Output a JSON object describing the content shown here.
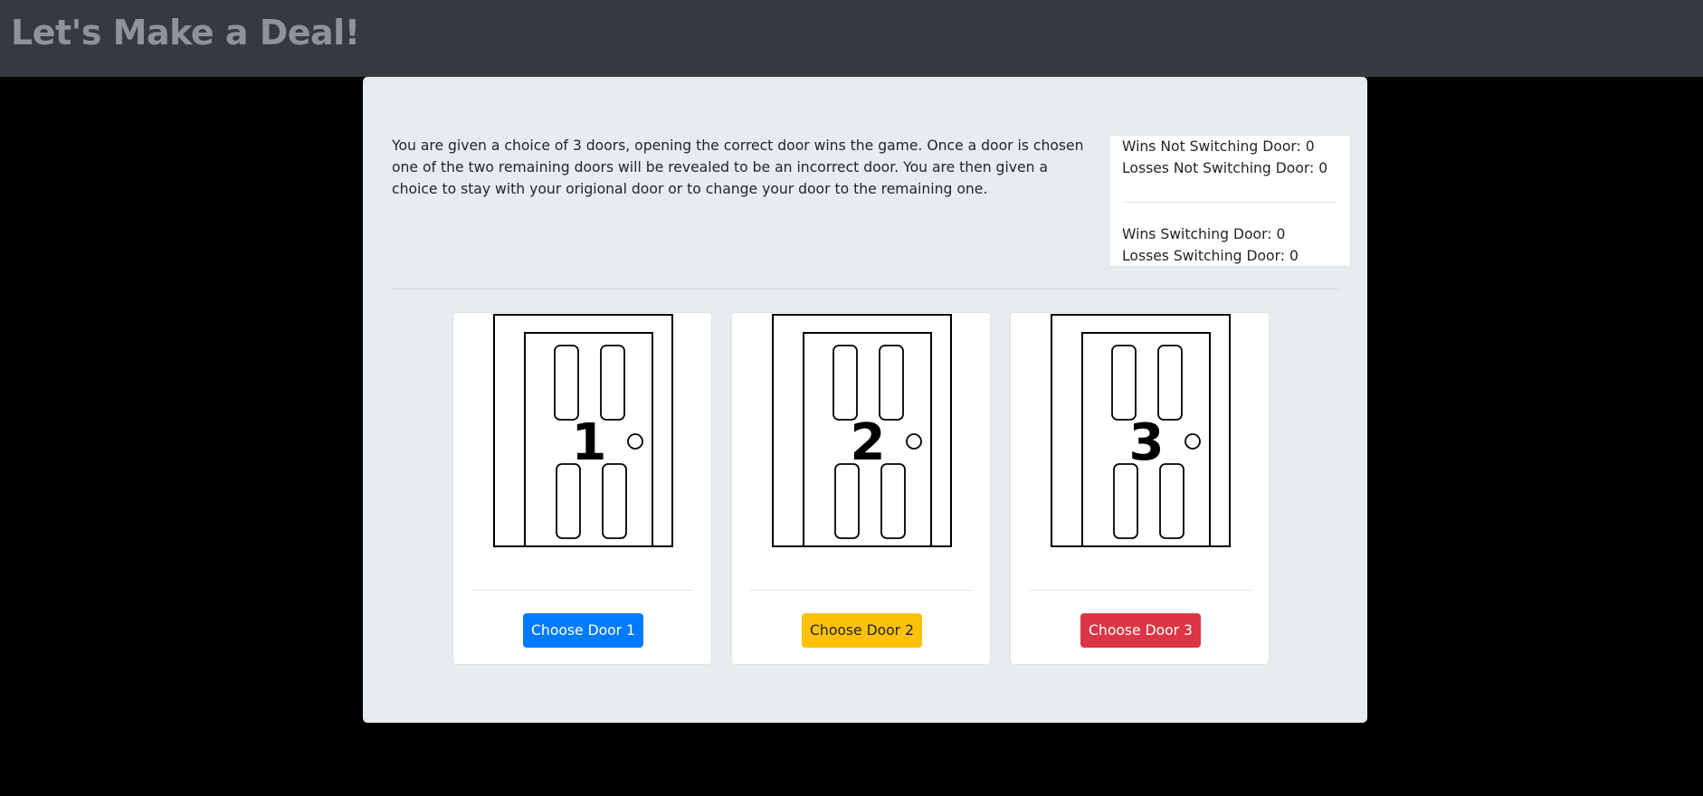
{
  "header": {
    "title": "Let's Make a Deal!"
  },
  "intro": {
    "text": "You are given a choice of 3 doors, opening the correct door wins the game. Once a door is chosen one of the two remaining doors will be revealed to be an incorrect door. You are then given a choice to stay with your origional door or to change your door to the remaining one."
  },
  "stats": {
    "wins_not_switching": {
      "label": "Wins Not Switching Door:",
      "value": "0"
    },
    "losses_not_switching": {
      "label": "Losses Not Switching Door:",
      "value": "0"
    },
    "wins_switching": {
      "label": "Wins Switching Door:",
      "value": "0"
    },
    "losses_switching": {
      "label": "Losses Switching Door:",
      "value": "0"
    }
  },
  "doors": [
    {
      "number": "1",
      "button_label": "Choose Door 1",
      "button_color": "#007bff"
    },
    {
      "number": "2",
      "button_label": "Choose Door 2",
      "button_color": "#ffc107"
    },
    {
      "number": "3",
      "button_label": "Choose Door 3",
      "button_color": "#dc3545"
    }
  ]
}
